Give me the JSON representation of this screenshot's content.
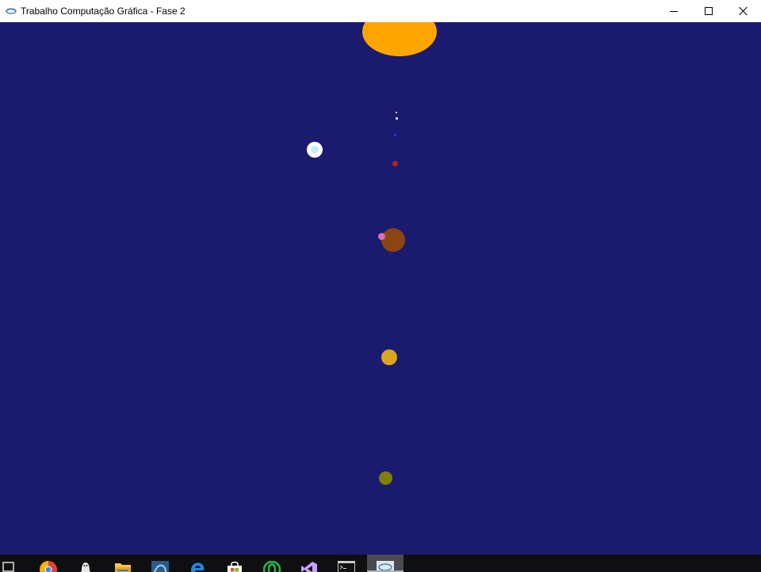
{
  "window": {
    "title": "Trabalho Computação Gráfica - Fase 2",
    "app_icon": "glut-icon",
    "controls": [
      "minimize-icon",
      "maximize-icon",
      "close-icon"
    ]
  },
  "scene": {
    "background_color": "#1a1a6e",
    "bodies": [
      {
        "name": "sun",
        "color": "#ffa500"
      },
      {
        "name": "star-small-1",
        "color": "#ffffff"
      },
      {
        "name": "star-small-2",
        "color": "#ffffff"
      },
      {
        "name": "planet-blue",
        "color": "#1e3cff"
      },
      {
        "name": "planet-red",
        "color": "#b22222"
      },
      {
        "name": "moon-white",
        "color": "#ffffff"
      },
      {
        "name": "moon-white-core",
        "color": "#cfe8ff"
      },
      {
        "name": "planet-brown",
        "color": "#8b4513"
      },
      {
        "name": "moon-pink",
        "color": "#e06cb0"
      },
      {
        "name": "planet-goldenrod",
        "color": "#daa520"
      },
      {
        "name": "planet-olive",
        "color": "#808000"
      }
    ]
  },
  "taskbar": {
    "items": [
      {
        "name": "task-view-icon",
        "active": false
      },
      {
        "name": "chrome-icon",
        "active": false
      },
      {
        "name": "linux-penguin-icon",
        "active": false
      },
      {
        "name": "file-explorer-icon",
        "active": false
      },
      {
        "name": "mysql-workbench-icon",
        "active": false
      },
      {
        "name": "edge-icon",
        "active": false
      },
      {
        "name": "store-icon",
        "active": false
      },
      {
        "name": "opera-icon",
        "active": false
      },
      {
        "name": "visual-studio-icon",
        "active": false
      },
      {
        "name": "terminal-icon",
        "active": false
      },
      {
        "name": "glut-app-icon",
        "active": true
      }
    ]
  }
}
